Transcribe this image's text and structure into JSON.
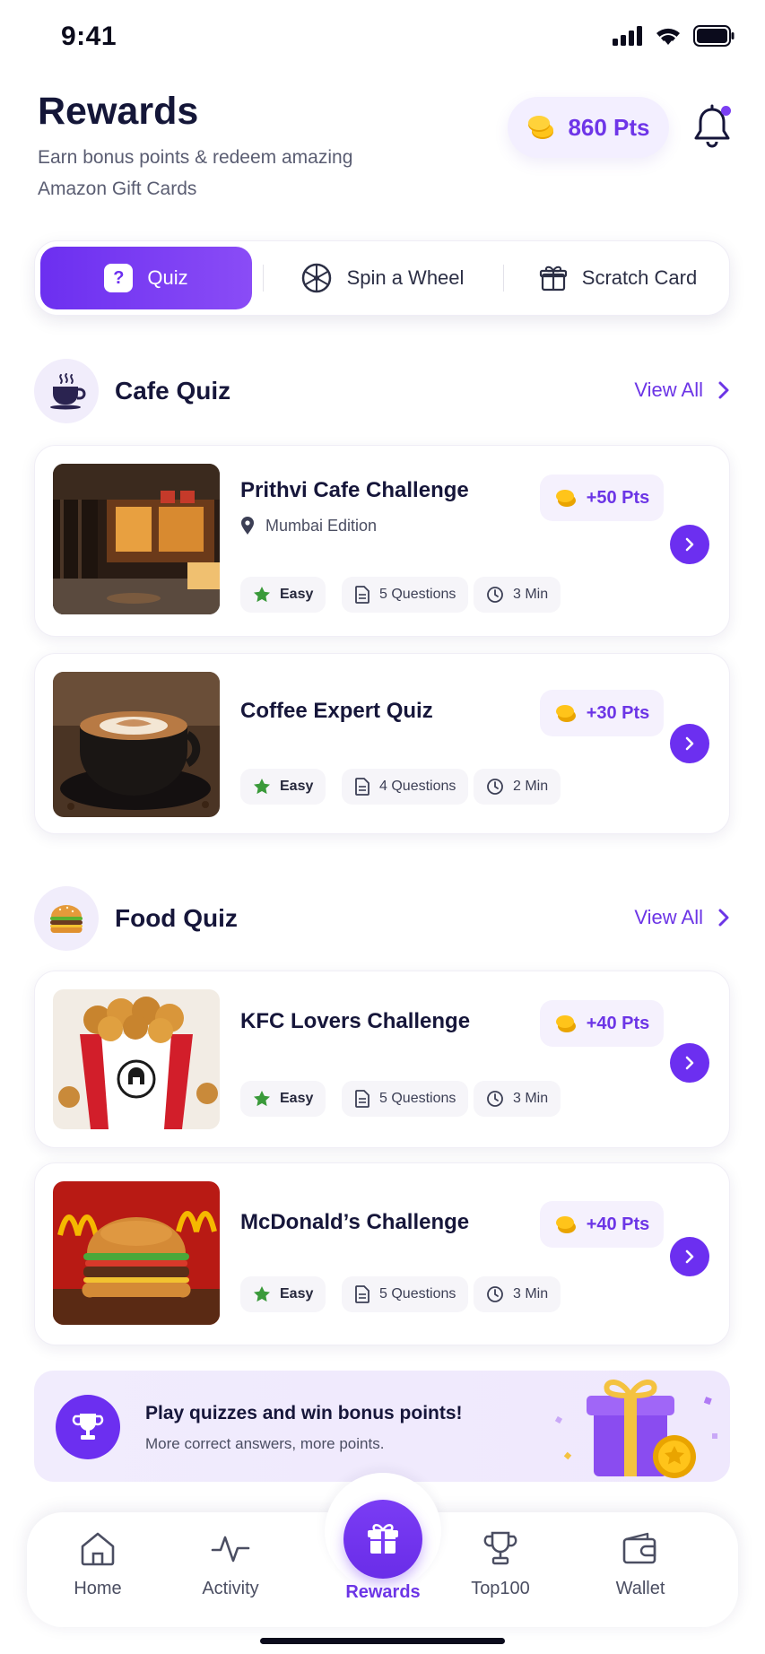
{
  "status_bar": {
    "time": "9:41"
  },
  "header": {
    "title": "Rewards",
    "subtitle": "Earn bonus points & redeem amazing Amazon Gift Cards",
    "points": "860 Pts"
  },
  "tabs": [
    {
      "label": "Quiz",
      "icon": "quiz-icon",
      "active": true
    },
    {
      "label": "Spin a Wheel",
      "icon": "wheel-icon",
      "active": false
    },
    {
      "label": "Scratch Card",
      "icon": "gift-icon",
      "active": false
    }
  ],
  "sections": [
    {
      "title": "Cafe Quiz",
      "icon": "coffee-cup-icon",
      "view_all": "View All",
      "cards": [
        {
          "title": "Prithvi Cafe Challenge",
          "location": "Mumbai Edition",
          "points": "+50 Pts",
          "difficulty": "Easy",
          "questions": "5 Questions",
          "duration": "3 Min",
          "image": "cafe-storefront-image"
        },
        {
          "title": "Coffee Expert Quiz",
          "points": "+30 Pts",
          "difficulty": "Easy",
          "questions": "4 Questions",
          "duration": "2 Min",
          "image": "latte-cup-image"
        }
      ]
    },
    {
      "title": "Food Quiz",
      "icon": "burger-icon",
      "view_all": "View All",
      "cards": [
        {
          "title": "KFC Lovers Challenge",
          "points": "+40 Pts",
          "difficulty": "Easy",
          "questions": "5 Questions",
          "duration": "3 Min",
          "image": "kfc-bucket-image"
        },
        {
          "title": "McDonald’s Challenge",
          "points": "+40 Pts",
          "difficulty": "Easy",
          "questions": "5 Questions",
          "duration": "3 Min",
          "image": "burger-image"
        }
      ]
    }
  ],
  "promo": {
    "title": "Play quizzes and win bonus points!",
    "subtitle": "More correct answers, more points."
  },
  "bottom_nav": [
    {
      "label": "Home",
      "icon": "home-icon"
    },
    {
      "label": "Activity",
      "icon": "activity-icon"
    },
    {
      "label": "Rewards",
      "icon": "gift-icon",
      "active": true
    },
    {
      "label": "Top100",
      "icon": "trophy-icon"
    },
    {
      "label": "Wallet",
      "icon": "wallet-icon"
    }
  ],
  "colors": {
    "accent": "#6c2ff0",
    "accent_text": "#6c35e6",
    "badge_bg": "#f5f1fd",
    "star": "#3a9a3a",
    "coin": "#f5b800"
  }
}
